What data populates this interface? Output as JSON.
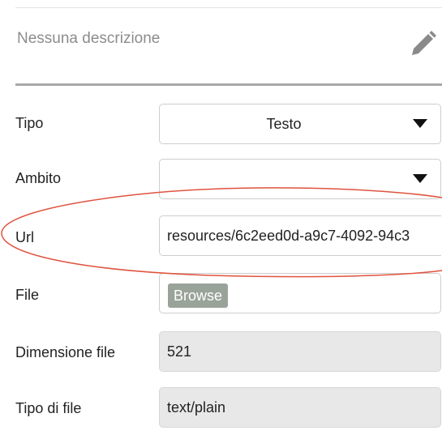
{
  "description": {
    "text": "Nessuna descrizione",
    "edit_icon": "pencil-icon"
  },
  "fields": {
    "tipo": {
      "label": "Tipo",
      "value": "Testo"
    },
    "ambito": {
      "label": "Ambito",
      "value": ""
    },
    "url": {
      "label": "Url",
      "value": "resources/6c2eed0d-a9c7-4092-94c3"
    },
    "file": {
      "label": "File",
      "button": "Browse"
    },
    "dimensione": {
      "label": "Dimensione file",
      "value": "521"
    },
    "tipo_file": {
      "label": "Tipo di file",
      "value": "text/plain"
    }
  },
  "colors": {
    "annotation_ellipse": "#e0533f",
    "browse_button": "#9aa39a",
    "readonly_bg": "#e8e8e8"
  }
}
